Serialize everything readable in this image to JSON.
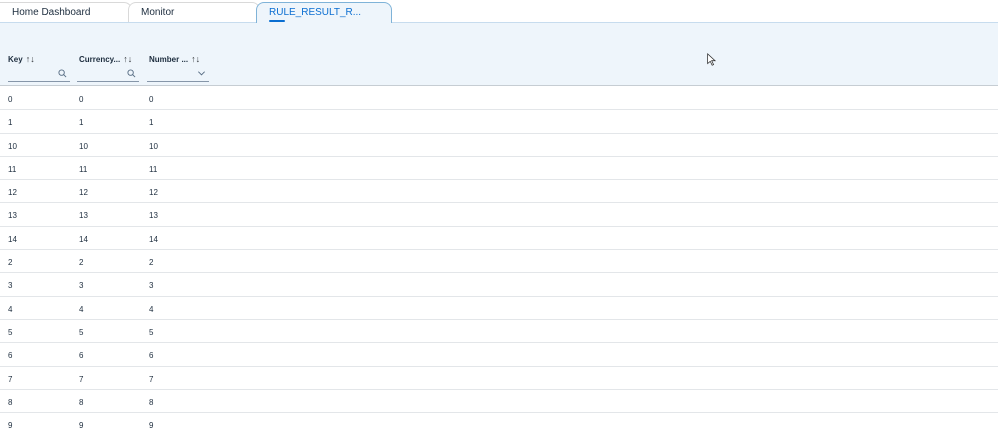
{
  "tabs": [
    {
      "label": "Home Dashboard"
    },
    {
      "label": "Monitor"
    },
    {
      "label": "RULE_RESULT_R..."
    }
  ],
  "columns": [
    {
      "label": "Key",
      "sort_icon": "↑↓",
      "filter_icon": "search-icon"
    },
    {
      "label": "Currency...",
      "sort_icon": "↑↓",
      "filter_icon": "search-icon"
    },
    {
      "label": "Number ...",
      "sort_icon": "↑↓",
      "filter_icon": "chevron-down-icon"
    }
  ],
  "rows": [
    [
      "0",
      "0",
      "0"
    ],
    [
      "1",
      "1",
      "1"
    ],
    [
      "10",
      "10",
      "10"
    ],
    [
      "11",
      "11",
      "11"
    ],
    [
      "12",
      "12",
      "12"
    ],
    [
      "13",
      "13",
      "13"
    ],
    [
      "14",
      "14",
      "14"
    ],
    [
      "2",
      "2",
      "2"
    ],
    [
      "3",
      "3",
      "3"
    ],
    [
      "4",
      "4",
      "4"
    ],
    [
      "5",
      "5",
      "5"
    ],
    [
      "6",
      "6",
      "6"
    ],
    [
      "7",
      "7",
      "7"
    ],
    [
      "8",
      "8",
      "8"
    ],
    [
      "9",
      "9",
      "9"
    ]
  ],
  "colors": {
    "accent": "#0a6ed1",
    "header_bg": "#eef5fb",
    "row_border": "#e3e6e9"
  }
}
